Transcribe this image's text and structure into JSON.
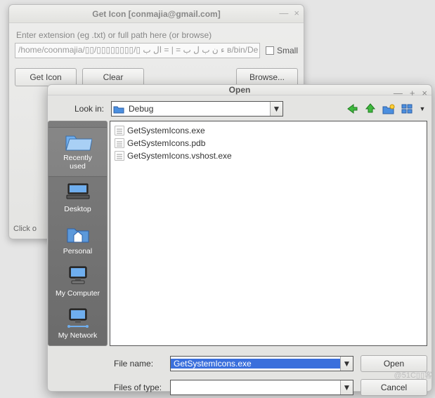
{
  "back_window": {
    "title": "Get Icon [conmajia@gmail.com]",
    "instruction": "Enter extension (eg .txt) or full path here (or browse)",
    "path_value": "/home/coonmajia/▯▯/▯▯▯▯▯▯▯▯/▯ ء ن ب ل ب = | = ال ب в/bin/De",
    "small_label": "Small",
    "btn_geticon": "Get Icon",
    "btn_clear": "Clear",
    "btn_browse": "Browse...",
    "footer": "Click o"
  },
  "open_dialog": {
    "title": "Open",
    "lookin_label": "Look in:",
    "lookin_value": "Debug",
    "places": {
      "recent": "Recently\nused",
      "desktop": "Desktop",
      "personal": "Personal",
      "my_computer": "My Computer",
      "my_network": "My Network"
    },
    "files": [
      "GetSystemIcons.exe",
      "GetSystemIcons.pdb",
      "GetSystemIcons.vshost.exe"
    ],
    "filename_label": "File name:",
    "filename_value": "GetSystemIcons.exe",
    "filetype_label": "Files of type:",
    "filetype_value": "",
    "open_btn": "Open",
    "cancel_btn": "Cancel"
  },
  "watermark": "@51C▯▯客"
}
